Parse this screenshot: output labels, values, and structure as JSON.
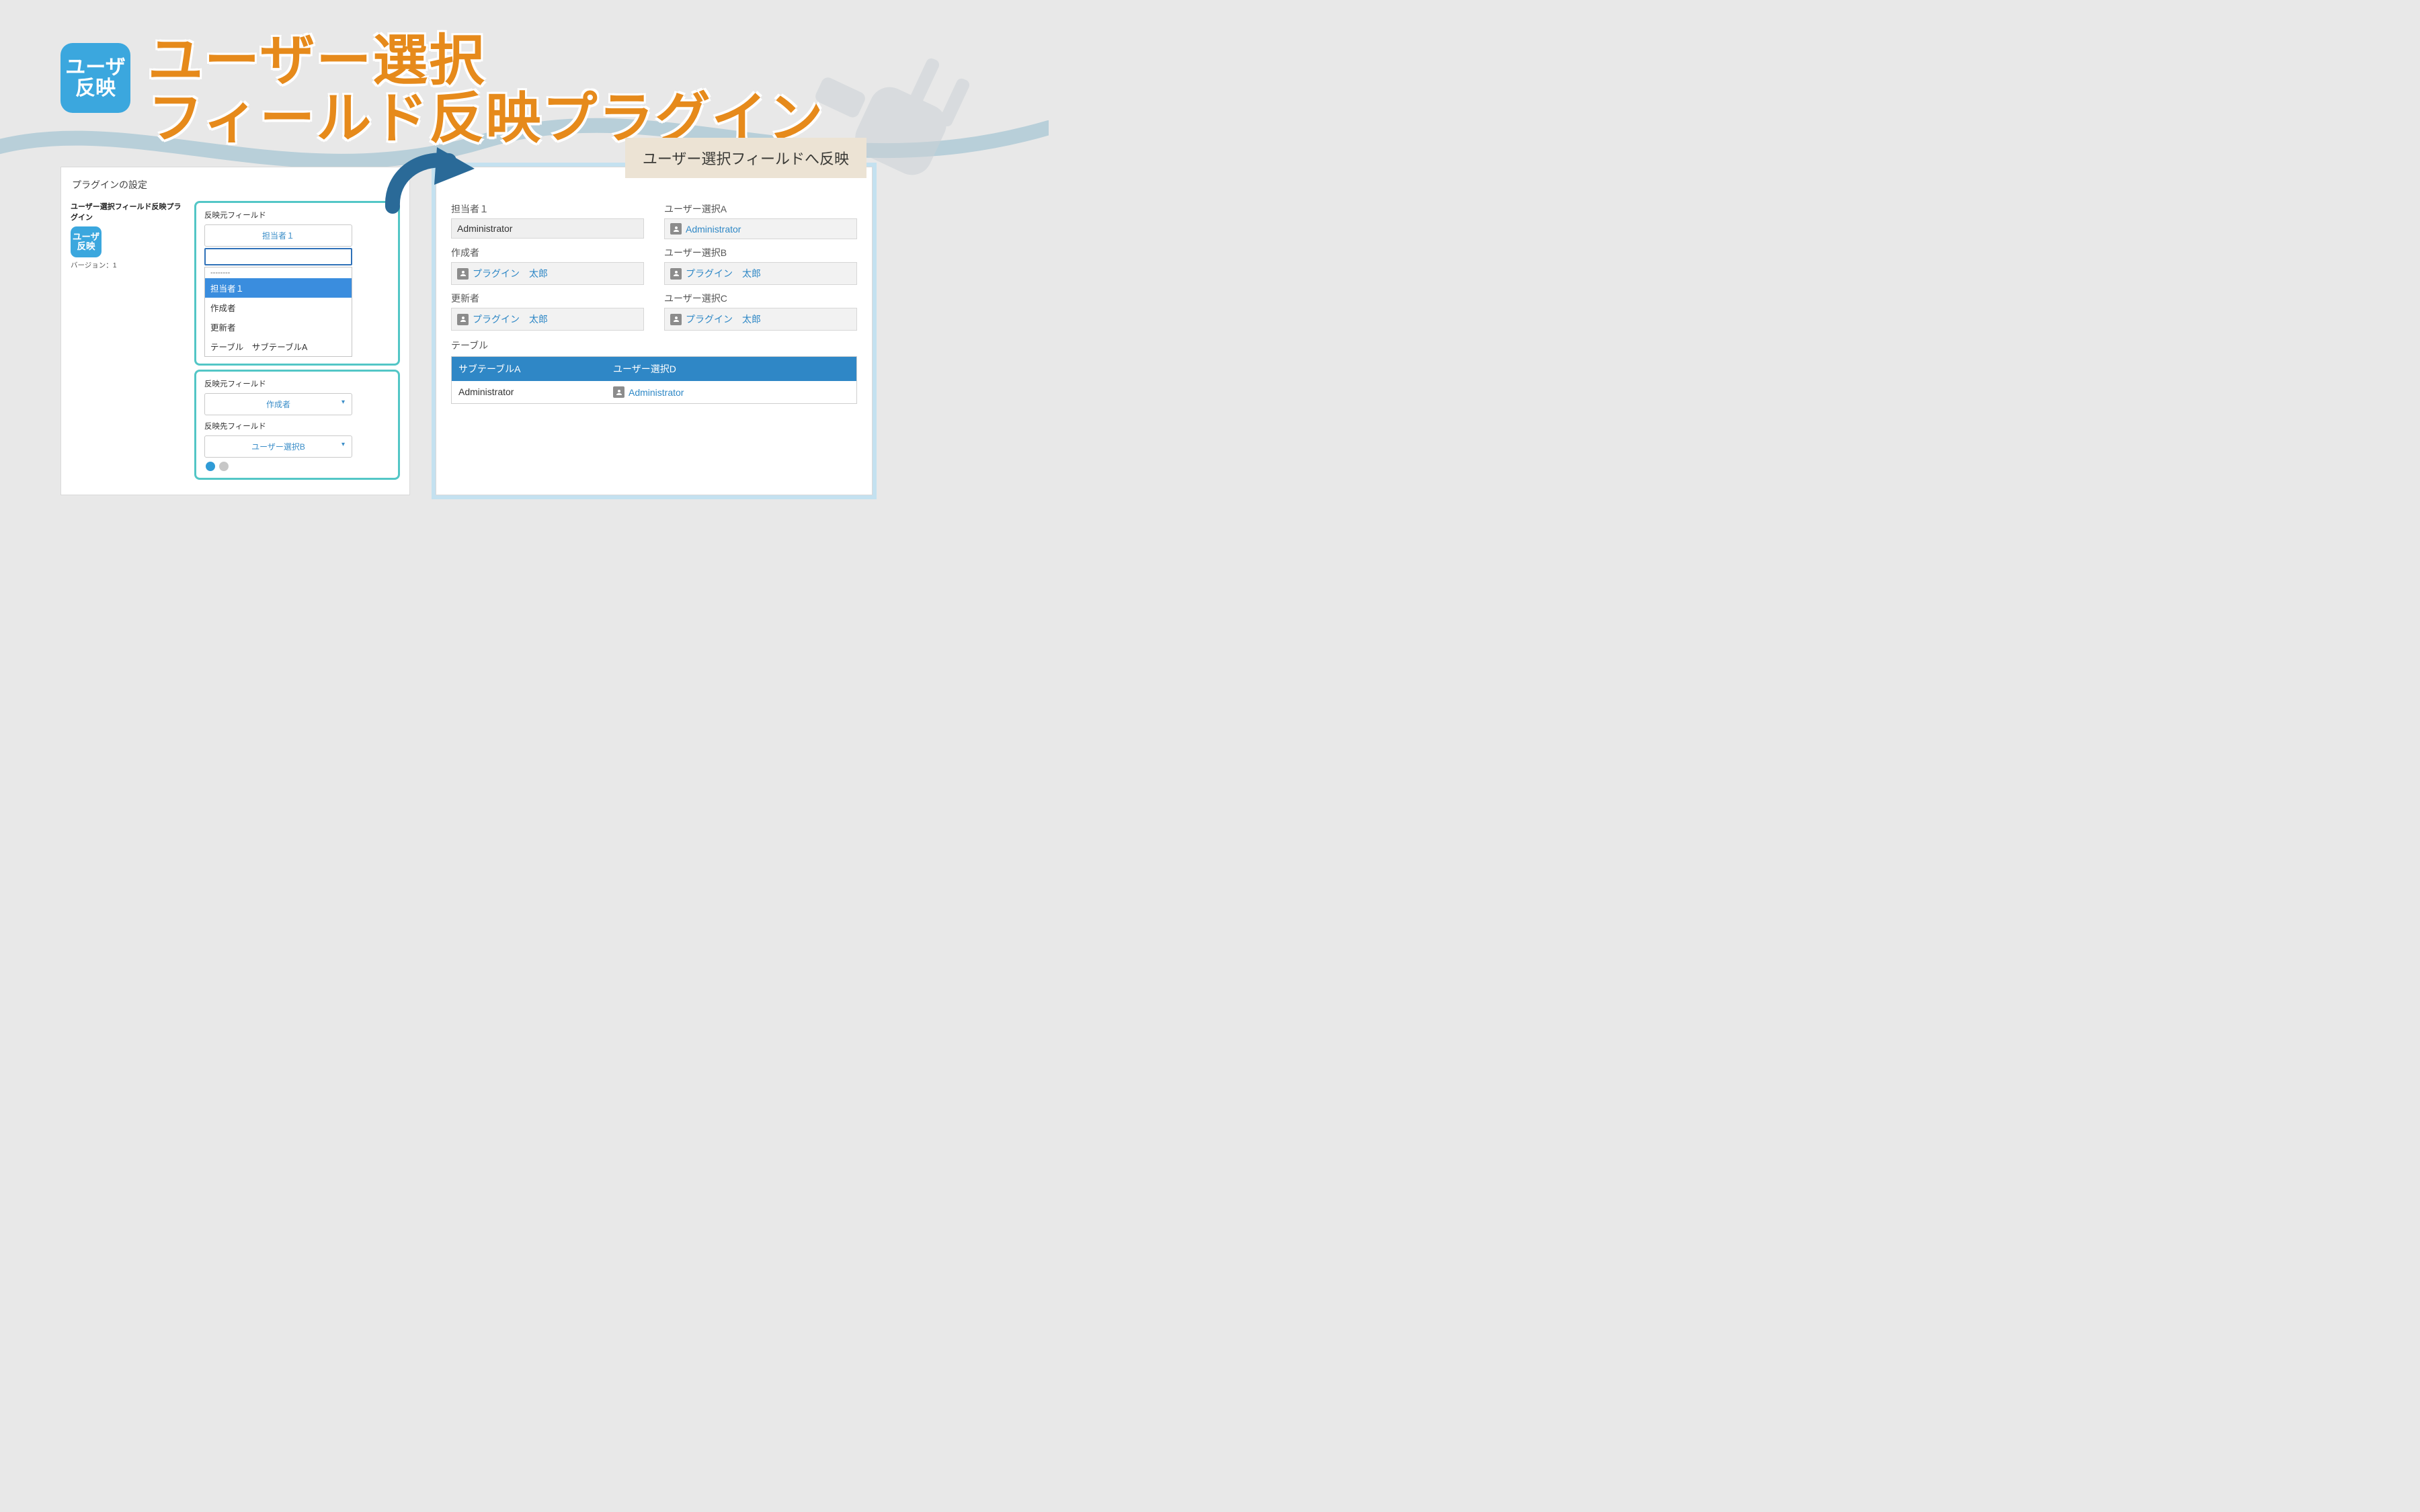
{
  "app_icon": {
    "line1": "ユーザ",
    "line2": "反映"
  },
  "title_line1": "ユーザー選択",
  "title_line2": "フィールド反映プラグイン",
  "left_panel": {
    "heading": "プラグインの設定",
    "plugin_name": "ユーザー選択フィールド反映プラグイン",
    "plugin_icon": {
      "line1": "ユーザ",
      "line2": "反映"
    },
    "version_label": "バージョン：1",
    "box1": {
      "field_label": "反映元フィールド",
      "selected": "担当者１",
      "search_value": "",
      "dropdown": {
        "separator": "--------",
        "items": [
          "担当者１",
          "作成者",
          "更新者",
          "テーブル　サブテーブルA"
        ],
        "selected_index": 0
      }
    },
    "box2": {
      "src_label": "反映元フィールド",
      "src_value": "作成者",
      "dst_label": "反映先フィールド",
      "dst_value": "ユーザー選択B"
    }
  },
  "callout": "ユーザー選択フィールドへ反映",
  "right_panel": {
    "rows": [
      {
        "left_label": "担当者１",
        "left_value": "Administrator",
        "right_label": "ユーザー選択A",
        "right_value": "Administrator"
      },
      {
        "left_label": "作成者",
        "left_value": "プラグイン　太郎",
        "right_label": "ユーザー選択B",
        "right_value": "プラグイン　太郎"
      },
      {
        "left_label": "更新者",
        "left_value": "プラグイン　太郎",
        "right_label": "ユーザー選択C",
        "right_value": "プラグイン　太郎"
      }
    ],
    "table_label": "テーブル",
    "table": {
      "headers": [
        "サブテーブルA",
        "ユーザー選択D"
      ],
      "row": [
        "Administrator",
        "Administrator"
      ]
    }
  }
}
